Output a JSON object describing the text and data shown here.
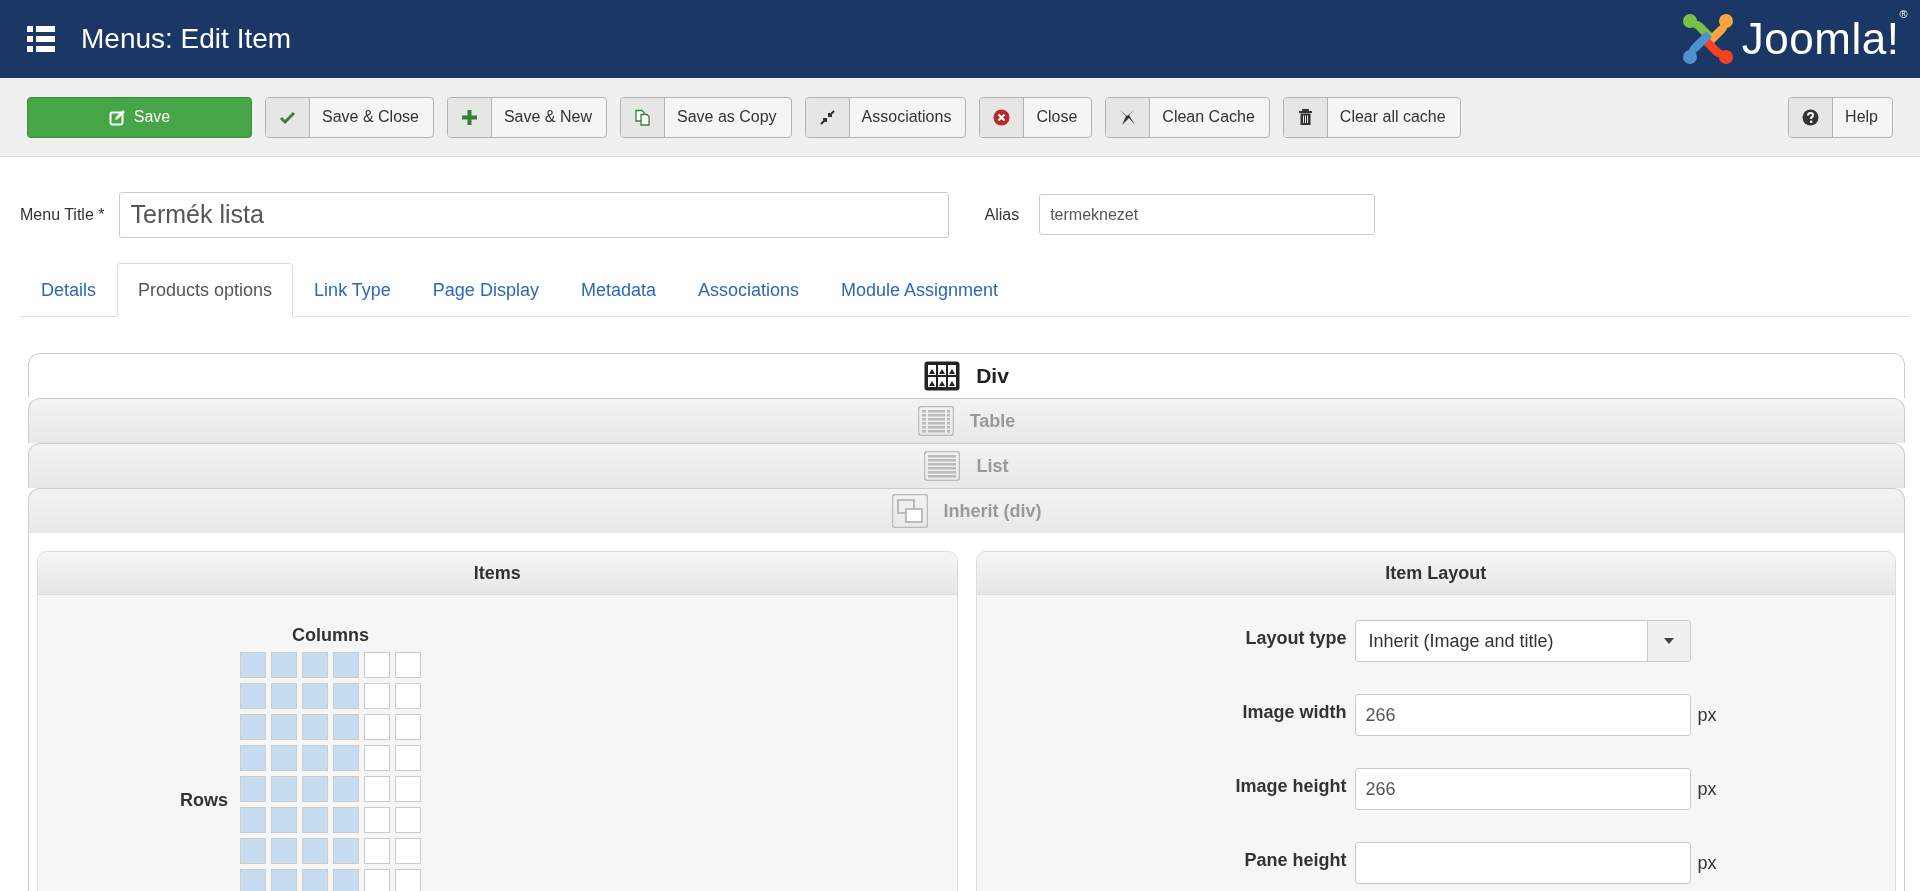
{
  "header": {
    "title": "Menus: Edit Item",
    "logo": "Joomla!$^{®}$"
  },
  "toolbar": {
    "buttons": [
      {
        "label": "Save",
        "kind": "save"
      },
      {
        "label": "Save & Close",
        "kind": "check"
      },
      {
        "label": "Save & New",
        "kind": "plus"
      },
      {
        "label": "Save as Copy",
        "kind": "copy"
      },
      {
        "label": "Associations",
        "kind": "shrink"
      },
      {
        "label": "Close",
        "kind": "close"
      },
      {
        "label": "Clean Cache",
        "kind": "flash"
      },
      {
        "label": "Clear all cache",
        "kind": "trash"
      }
    ],
    "help": {
      "label": "Help",
      "kind": "help"
    }
  },
  "form": {
    "menu_title": {
      "label": "Menu Title *",
      "value": "Termék lista"
    },
    "alias": {
      "label": "Alias",
      "value": "termeknezet"
    }
  },
  "tabs": [
    {
      "label": "Details",
      "selected": false
    },
    {
      "label": "Products options",
      "selected": true
    },
    {
      "label": "Link Type",
      "selected": false
    },
    {
      "label": "Page Display",
      "selected": false
    },
    {
      "label": "Metadata",
      "selected": false
    },
    {
      "label": "Associations",
      "selected": false
    },
    {
      "label": "Module Assignment",
      "selected": false
    }
  ],
  "layout_options": [
    {
      "label": "Div",
      "kind": "div",
      "selected": true
    },
    {
      "label": "Table",
      "kind": "table",
      "selected": false
    },
    {
      "label": "List",
      "kind": "list",
      "selected": false
    },
    {
      "label": "Inherit (div)",
      "kind": "inherit",
      "selected": false
    }
  ],
  "items_panel": {
    "title": "Items",
    "columns_label": "Columns",
    "rows_label": "Rows",
    "grid_rows": [
      {
        "cells": [
          {
            "selected": true
          },
          {
            "selected": true
          },
          {
            "selected": true
          },
          {
            "selected": true
          },
          {
            "selected": false
          },
          {
            "selected": false
          }
        ]
      },
      {
        "cells": [
          {
            "selected": true
          },
          {
            "selected": true
          },
          {
            "selected": true
          },
          {
            "selected": true
          },
          {
            "selected": false
          },
          {
            "selected": false
          }
        ]
      },
      {
        "cells": [
          {
            "selected": true
          },
          {
            "selected": true
          },
          {
            "selected": true
          },
          {
            "selected": true
          },
          {
            "selected": false
          },
          {
            "selected": false
          }
        ]
      },
      {
        "cells": [
          {
            "selected": true
          },
          {
            "selected": true
          },
          {
            "selected": true
          },
          {
            "selected": true
          },
          {
            "selected": false
          },
          {
            "selected": false
          }
        ]
      },
      {
        "cells": [
          {
            "selected": true
          },
          {
            "selected": true
          },
          {
            "selected": true
          },
          {
            "selected": true
          },
          {
            "selected": false
          },
          {
            "selected": false
          }
        ]
      },
      {
        "cells": [
          {
            "selected": true
          },
          {
            "selected": true
          },
          {
            "selected": true
          },
          {
            "selected": true
          },
          {
            "selected": false
          },
          {
            "selected": false
          }
        ]
      },
      {
        "cells": [
          {
            "selected": true
          },
          {
            "selected": true
          },
          {
            "selected": true
          },
          {
            "selected": true
          },
          {
            "selected": false
          },
          {
            "selected": false
          }
        ]
      },
      {
        "cells": [
          {
            "selected": true
          },
          {
            "selected": true
          },
          {
            "selected": true
          },
          {
            "selected": true
          },
          {
            "selected": false
          },
          {
            "selected": false
          }
        ]
      }
    ]
  },
  "item_layout_panel": {
    "title": "Item Layout",
    "fields": [
      {
        "label": "Layout type",
        "kind": "select",
        "value": "Inherit (Image and title)"
      },
      {
        "label": "Image width",
        "kind": "text",
        "value": "266",
        "unit": "px"
      },
      {
        "label": "Image height",
        "kind": "text",
        "value": "266",
        "unit": "px"
      },
      {
        "label": "Pane height",
        "kind": "text",
        "unit": "px"
      }
    ]
  }
}
